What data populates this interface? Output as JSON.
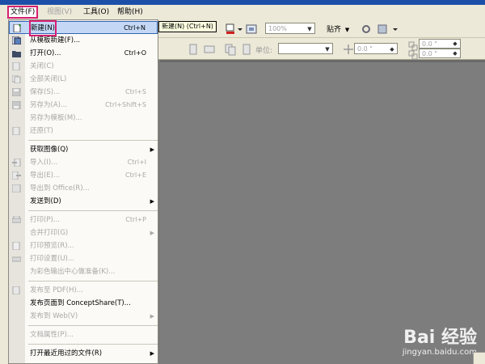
{
  "menubar": {
    "items": [
      {
        "label": "文件(F)",
        "state": "active"
      },
      {
        "label": "视图(V)",
        "state": "disabled"
      },
      {
        "label": "工具(O)",
        "state": "normal"
      },
      {
        "label": "帮助(H)",
        "state": "normal"
      }
    ]
  },
  "tooltip": {
    "text": "新建(N) (Ctrl+N)"
  },
  "toolbar": {
    "zoom_value": "100%",
    "snap_label": "贴齐",
    "unit_label": "单位:",
    "nudge_value": "0.0 \"",
    "dup_x": "0.0 \"",
    "dup_y": "0.0 \""
  },
  "file_menu": {
    "items": [
      {
        "label": "新建(N)",
        "shortcut": "Ctrl+N",
        "disabled": false,
        "highlighted": true,
        "icon": "new-document-icon"
      },
      {
        "label": "从模板新建(F)...",
        "shortcut": "",
        "disabled": false,
        "icon": "template-icon"
      },
      {
        "label": "打开(O)...",
        "shortcut": "Ctrl+O",
        "disabled": false,
        "icon": "open-folder-icon"
      },
      {
        "label": "关闭(C)",
        "shortcut": "",
        "disabled": true,
        "icon": "close-document-icon"
      },
      {
        "label": "全部关闭(L)",
        "shortcut": "",
        "disabled": true,
        "icon": "close-all-icon"
      },
      {
        "label": "保存(S)...",
        "shortcut": "Ctrl+S",
        "disabled": true,
        "icon": "save-icon"
      },
      {
        "label": "另存为(A)...",
        "shortcut": "Ctrl+Shift+S",
        "disabled": true,
        "icon": "save-as-icon"
      },
      {
        "label": "另存为模板(M)...",
        "shortcut": "",
        "disabled": true,
        "icon": ""
      },
      {
        "label": "还原(T)",
        "shortcut": "",
        "disabled": true,
        "icon": "revert-icon"
      },
      {
        "label": "获取图像(Q)",
        "shortcut": "",
        "disabled": false,
        "submenu": true,
        "icon": ""
      },
      {
        "label": "导入(I)...",
        "shortcut": "Ctrl+I",
        "disabled": true,
        "icon": "import-icon"
      },
      {
        "label": "导出(E)...",
        "shortcut": "Ctrl+E",
        "disabled": true,
        "icon": "export-icon"
      },
      {
        "label": "导出到 Office(R)...",
        "shortcut": "",
        "disabled": true,
        "icon": "export-office-icon"
      },
      {
        "label": "发送到(D)",
        "shortcut": "",
        "disabled": false,
        "submenu": true,
        "icon": ""
      },
      {
        "label": "打印(P)...",
        "shortcut": "Ctrl+P",
        "disabled": true,
        "icon": "print-icon"
      },
      {
        "label": "合并打印(G)",
        "shortcut": "",
        "disabled": true,
        "submenu": true,
        "icon": ""
      },
      {
        "label": "打印预览(R)...",
        "shortcut": "",
        "disabled": true,
        "icon": "print-preview-icon"
      },
      {
        "label": "打印设置(U)...",
        "shortcut": "",
        "disabled": true,
        "icon": "print-setup-icon"
      },
      {
        "label": "为彩色输出中心做准备(K)...",
        "shortcut": "",
        "disabled": true,
        "icon": ""
      },
      {
        "label": "发布至 PDF(H)...",
        "shortcut": "",
        "disabled": true,
        "icon": "pdf-icon"
      },
      {
        "label": "发布页面到 ConceptShare(T)...",
        "shortcut": "",
        "disabled": false,
        "icon": ""
      },
      {
        "label": "发布到 Web(V)",
        "shortcut": "",
        "disabled": true,
        "submenu": true,
        "icon": ""
      },
      {
        "label": "文档属性(P)...",
        "shortcut": "",
        "disabled": true,
        "icon": ""
      },
      {
        "label": "打开最近用过的文件(R)",
        "shortcut": "",
        "disabled": false,
        "submenu": true,
        "icon": ""
      }
    ]
  },
  "watermark": {
    "brand": "Bai  经验",
    "url": "jingyan.baidu.com"
  },
  "colors": {
    "menubar_bg": "#ece9d8",
    "canvas": "#7d7d7d",
    "highlight": "#c4d8f6",
    "annotation": "#d62070"
  }
}
